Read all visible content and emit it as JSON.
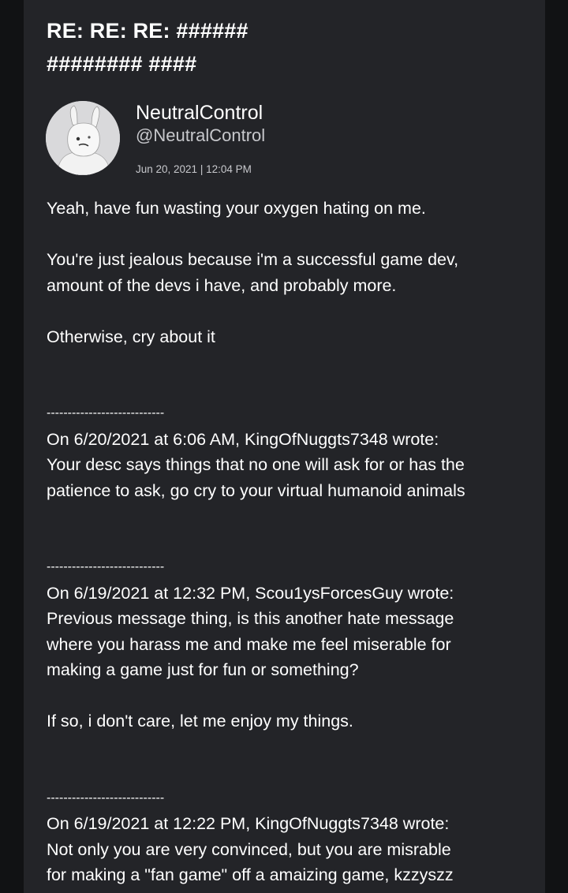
{
  "subject": {
    "line1": "RE: RE: RE: ######",
    "line2": "######## ####"
  },
  "sender": {
    "name": "NeutralControl",
    "handle": "@NeutralControl",
    "date": "Jun 20, 2021 | 12:04 PM"
  },
  "body_lines": [
    "Yeah, have fun wasting your oxygen hating on me.",
    "",
    "You're just jealous because i'm a successful game dev,",
    "amount of the devs i have, and probably more.",
    "",
    "Otherwise, cry about it",
    "",
    "",
    "----------------------------",
    "On 6/20/2021 at 6:06 AM, KingOfNuggts7348 wrote:",
    "Your desc says things that no one will ask for or has the",
    "patience to ask, go cry to your virtual humanoid animals",
    "",
    "",
    "----------------------------",
    "On 6/19/2021 at 12:32 PM, Scou1ysForcesGuy wrote:",
    "Previous message thing, is this another hate message",
    "where you harass me and make me feel miserable for",
    "making a game just for fun or something?",
    "",
    "If so, i don't care, let me enjoy my things.",
    "",
    "",
    "----------------------------",
    "On 6/19/2021 at 12:22 PM, KingOfNuggts7348 wrote:",
    "Not only you are very convinced, but you are misrable",
    "for making a \"fan game\" off a amaizing game, kzzyszz"
  ]
}
